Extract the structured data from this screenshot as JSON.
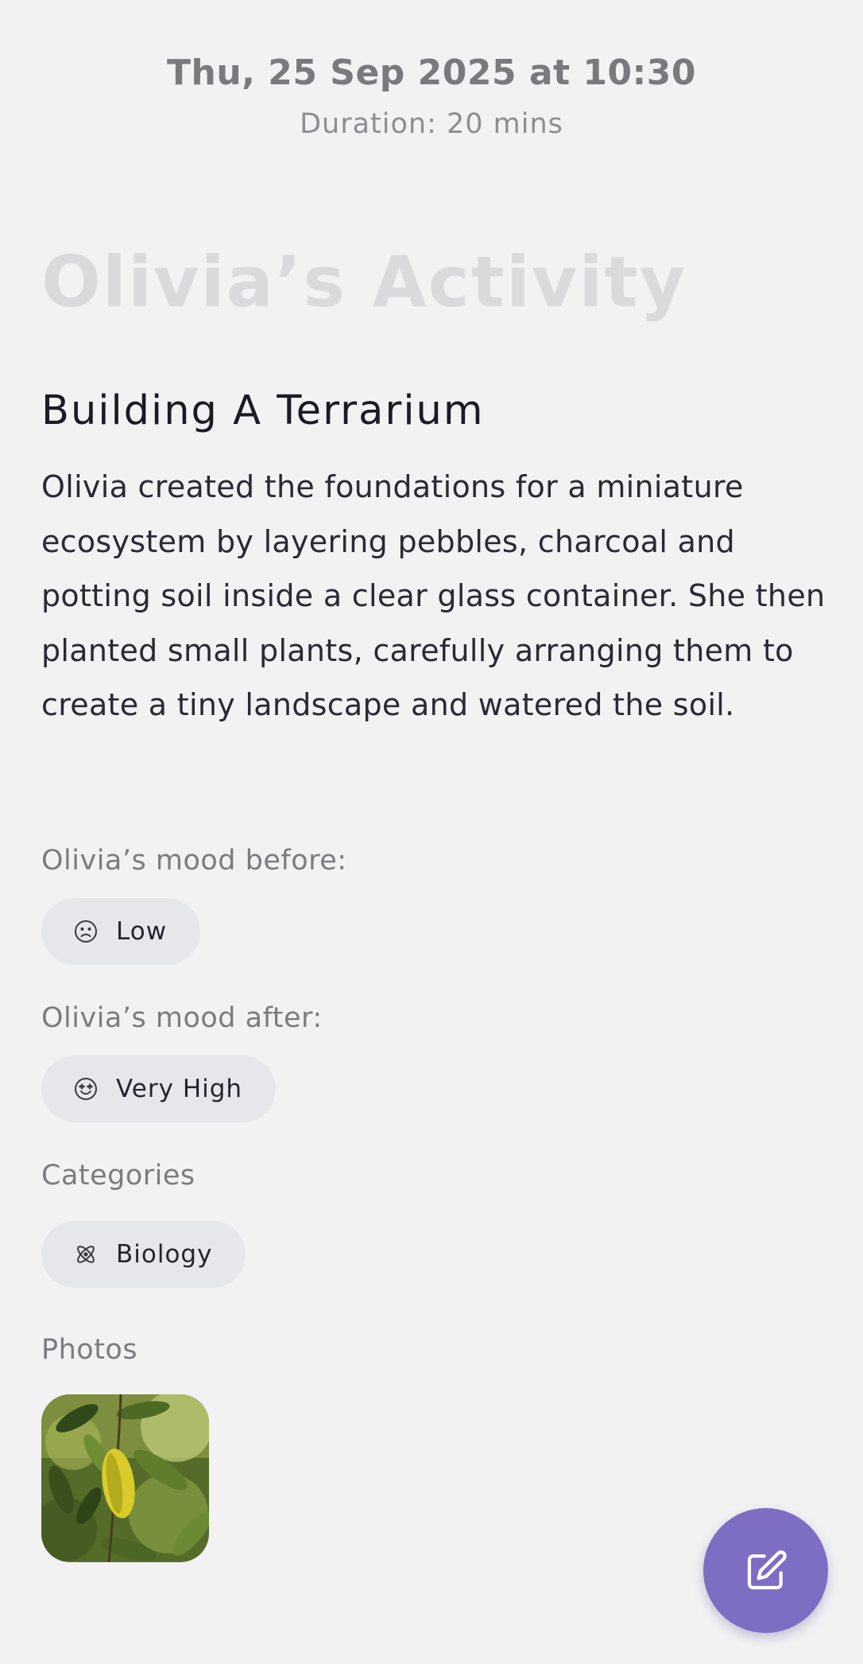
{
  "header": {
    "datetime": "Thu, 25 Sep 2025 at 10:30",
    "duration": "Duration: 20 mins"
  },
  "page_title": "Olivia’s Activity",
  "activity": {
    "title": "Building A Terrarium",
    "description": "Olivia created the foundations for a miniature ecosystem by layering pebbles, charcoal and potting soil inside a clear glass container. She then planted small plants, carefully arranging them to create a tiny landscape and watered the soil."
  },
  "mood_before": {
    "label": "Olivia’s mood before:",
    "value": "Low",
    "icon": "frown-face-icon"
  },
  "mood_after": {
    "label": "Olivia’s mood after:",
    "value": "Very High",
    "icon": "star-eyes-face-icon"
  },
  "categories": {
    "label": "Categories",
    "items": [
      {
        "label": "Biology",
        "icon": "atom-icon"
      }
    ]
  },
  "photos": {
    "label": "Photos",
    "items": [
      {
        "subject": "green leaves with a yellow leaf"
      }
    ]
  },
  "fab": {
    "icon": "edit-icon"
  },
  "colors": {
    "background": "#f2f2f3",
    "chip": "#e6e7ea",
    "fab": "#7d6dc3"
  }
}
